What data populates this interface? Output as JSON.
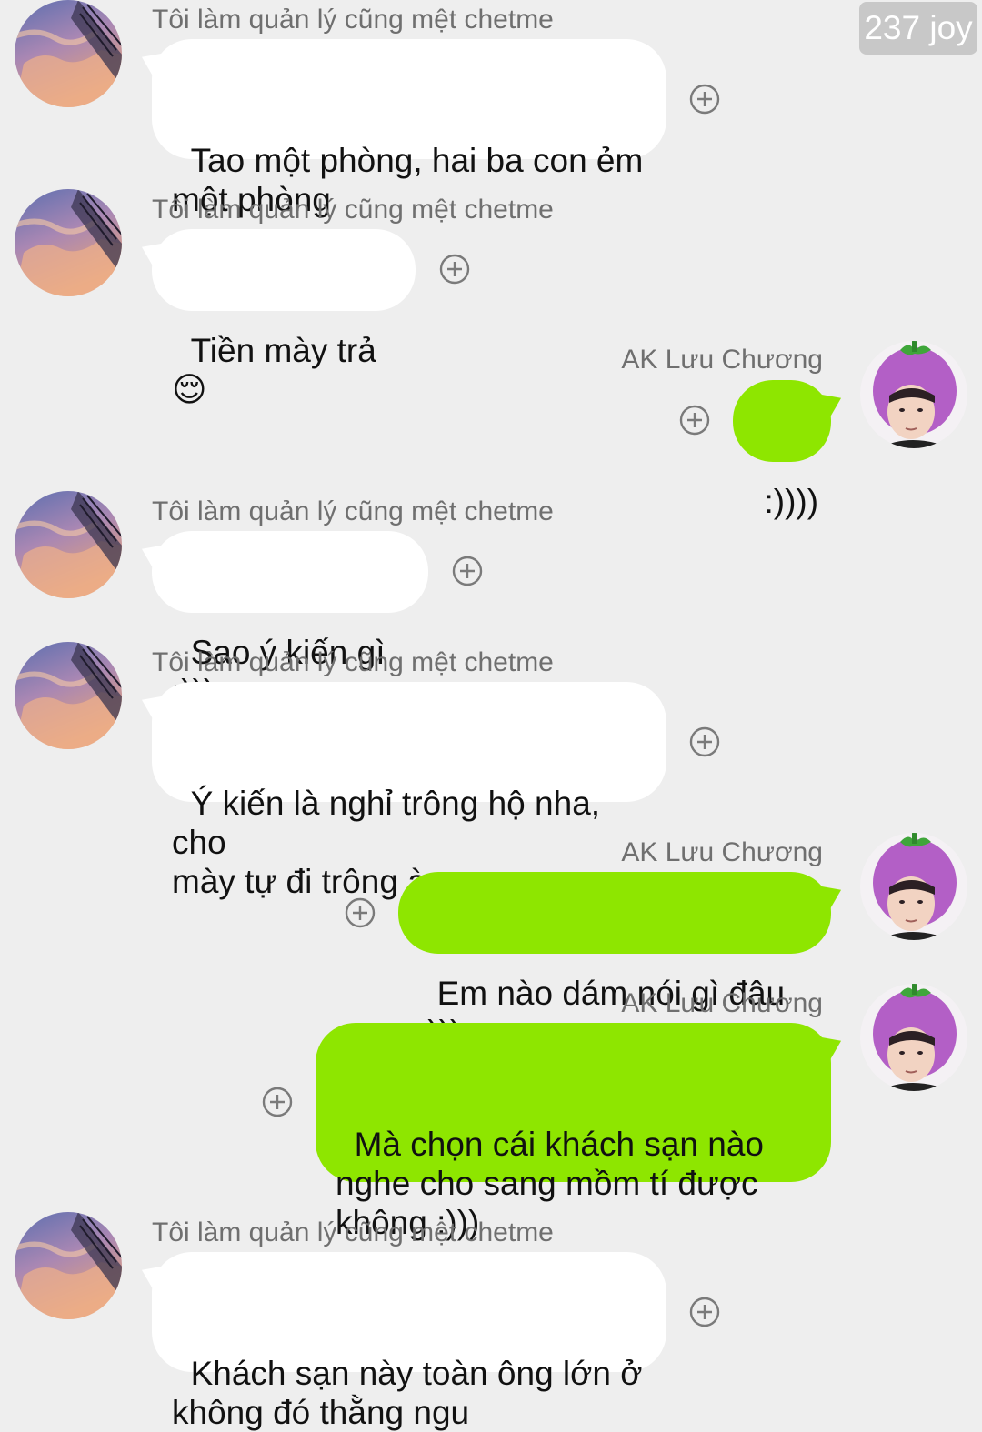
{
  "watermark": "237 joy",
  "colors": {
    "background": "#eeeeee",
    "incoming_bubble": "#ffffff",
    "outgoing_bubble": "#8ee600",
    "sender_name": "#6f6f6f"
  },
  "icons": {
    "add_reaction": "plus-circle-icon"
  },
  "messages": [
    {
      "direction": "incoming",
      "sender": "Tôi làm quản lý cũng mệt chetme",
      "text": "Tao một phòng, hai ba con ẻm\nmột phòng"
    },
    {
      "direction": "incoming",
      "sender": "Tôi làm quản lý cũng mệt chetme",
      "text": "Tiền mày trả 😌"
    },
    {
      "direction": "outgoing",
      "sender": "AK Lưu Chương",
      "text": ":))))"
    },
    {
      "direction": "incoming",
      "sender": "Tôi làm quản lý cũng mệt chetme",
      "text": "Sao ý kiến gì :)))"
    },
    {
      "direction": "incoming",
      "sender": "Tôi làm quản lý cũng mệt chetme",
      "text": "Ý kiến là nghỉ trông hộ nha, cho\nmày tự đi trông à"
    },
    {
      "direction": "outgoing",
      "sender": "AK Lưu Chương",
      "text": "Em nào dám nói gì đâu :)))"
    },
    {
      "direction": "outgoing",
      "sender": "AK Lưu Chương",
      "text": "Mà chọn cái khách sạn nào\nnghe cho sang mồm tí được\nkhông :)))"
    },
    {
      "direction": "incoming",
      "sender": "Tôi làm quản lý cũng mệt chetme",
      "text": "Khách sạn này toàn ông lớn ở\nkhông đó thằng ngu"
    }
  ]
}
